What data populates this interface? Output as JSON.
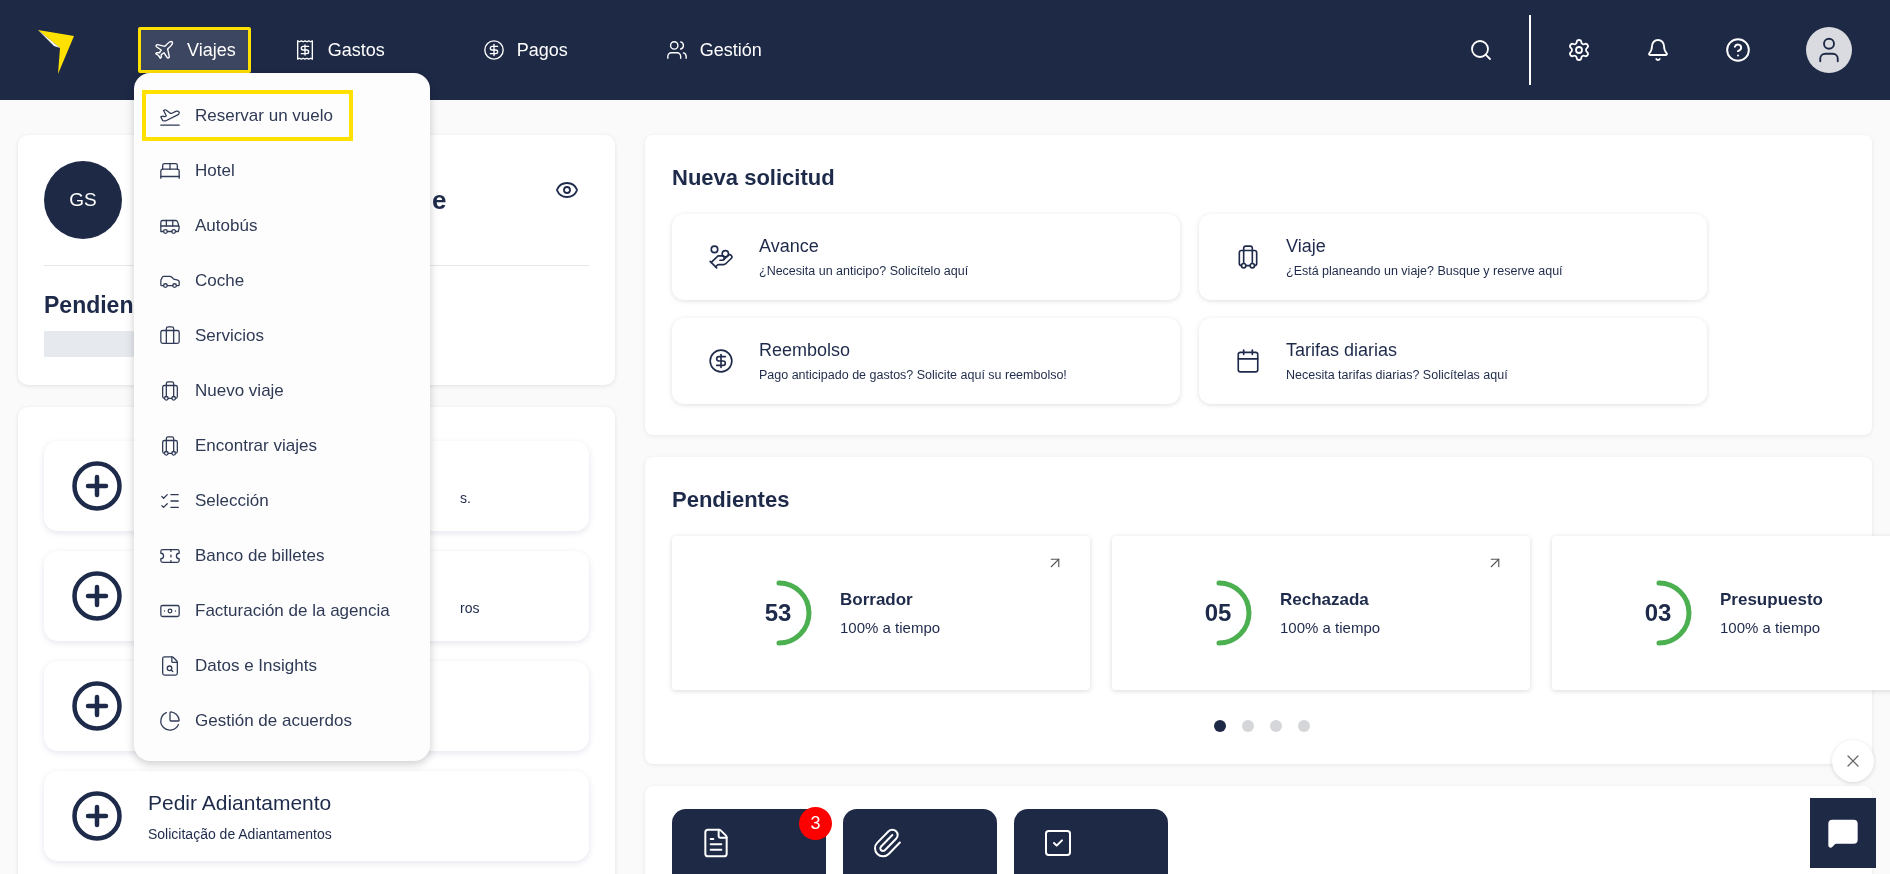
{
  "nav": {
    "items": [
      {
        "label": "Viajes",
        "selected": true
      },
      {
        "label": "Gastos",
        "selected": false
      },
      {
        "label": "Pagos",
        "selected": false
      },
      {
        "label": "Gestión",
        "selected": false
      }
    ]
  },
  "menu": {
    "items": [
      {
        "label": "Reservar un vuelo",
        "selected": true
      },
      {
        "label": "Hotel",
        "selected": false
      },
      {
        "label": "Autobús",
        "selected": false
      },
      {
        "label": "Coche",
        "selected": false
      },
      {
        "label": "Servicios",
        "selected": false
      },
      {
        "label": "Nuevo viaje",
        "selected": false
      },
      {
        "label": "Encontrar viajes",
        "selected": false
      },
      {
        "label": "Selección",
        "selected": false
      },
      {
        "label": "Banco de billetes",
        "selected": false
      },
      {
        "label": "Facturación de la agencia",
        "selected": false
      },
      {
        "label": "Datos e Insights",
        "selected": false
      },
      {
        "label": "Gestión de acuerdos",
        "selected": false
      }
    ]
  },
  "profile": {
    "initials": "GS",
    "name_fragment": "e",
    "section_fragment": "Pendien"
  },
  "actions": [
    {
      "kind": "plus",
      "subtitle_fragment": "s."
    },
    {
      "kind": "plus",
      "subtitle_fragment": "ros"
    },
    {
      "kind": "plus"
    },
    {
      "kind": "plus",
      "title": "Pedir Adiantamento",
      "subtitle": "Solicitação de Adiantamentos"
    }
  ],
  "new_request": {
    "title": "Nueva solicitud",
    "tiles": [
      {
        "title": "Avance",
        "subtitle": "¿Necesita un anticipo? Solicítelo aquí"
      },
      {
        "title": "Viaje",
        "subtitle": "¿Está planeando un viaje? Busque y reserve aquí"
      },
      {
        "title": "Reembolso",
        "subtitle": "Pago anticipado de gastos? Solicite aquí su reembolso!"
      },
      {
        "title": "Tarifas diarias",
        "subtitle": "Necesita tarifas diarias? Solicítelas aquí"
      }
    ]
  },
  "pending": {
    "title": "Pendientes",
    "tiles": [
      {
        "count": "53",
        "label": "Borrador",
        "note": "100% a tiempo"
      },
      {
        "count": "05",
        "label": "Rechazada",
        "note": "100% a tiempo"
      },
      {
        "count": "03",
        "label": "Presupuesto",
        "note": "100% a tiempo"
      }
    ],
    "dots": [
      {
        "selected": true
      },
      {
        "selected": false
      },
      {
        "selected": false
      },
      {
        "selected": false
      }
    ]
  },
  "shortcuts": [
    {
      "kind": "document",
      "badge": "3"
    },
    {
      "kind": "attachment"
    },
    {
      "kind": "checklist"
    }
  ]
}
